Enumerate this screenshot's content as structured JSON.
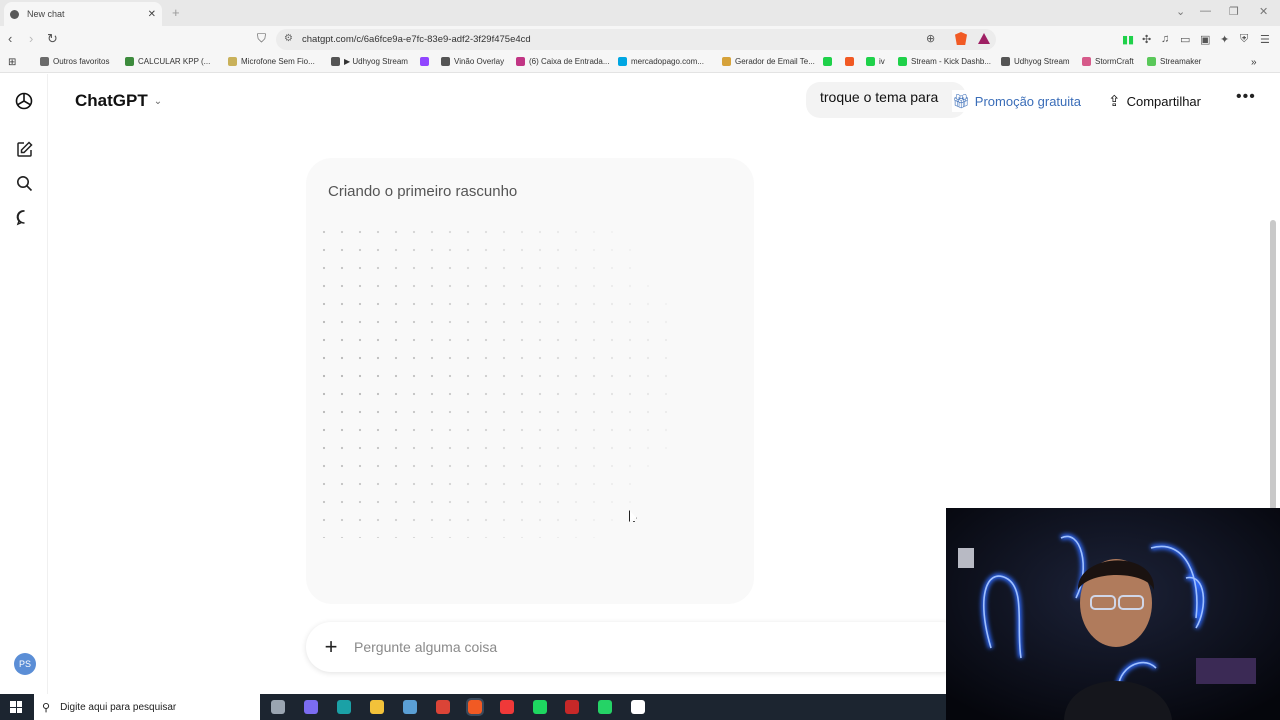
{
  "browser": {
    "tab_title": "New chat",
    "tab_close": "✕",
    "new_tab": "+",
    "url": "chatgpt.com/c/6a6fce9a-e7fc-83e9-adf2-3f29f475e4cd",
    "bookmarks": [
      {
        "label": "Outros favoritos",
        "color": "#6b6b6b"
      },
      {
        "label": "CALCULAR KPP (...",
        "color": "#3d8b3d"
      },
      {
        "label": "Microfone Sem Fio...",
        "color": "#c9b15a"
      },
      {
        "label": "▶ Udhyog Stream",
        "color": "#555555"
      },
      {
        "label": "",
        "color": "#9146ff"
      },
      {
        "label": "Vinão Overlay",
        "color": "#555555"
      },
      {
        "label": "(6) Caixa de Entrada...",
        "color": "#c13584"
      },
      {
        "label": "mercadopago.com...",
        "color": "#00a6e2"
      },
      {
        "label": "Gerador de Email Te...",
        "color": "#d6a23a"
      },
      {
        "label": "",
        "color": "#1fd14a"
      },
      {
        "label": "",
        "color": "#f15a24"
      },
      {
        "label": "iv",
        "color": "#1fd14a"
      },
      {
        "label": "Stream - Kick Dashb...",
        "color": "#1fd14a"
      },
      {
        "label": "Udhyog Stream",
        "color": "#555555"
      },
      {
        "label": "StormCraft",
        "color": "#d65a8a"
      },
      {
        "label": "Streamaker",
        "color": "#5ac85a"
      }
    ]
  },
  "app": {
    "model_name": "ChatGPT",
    "toast_text": "troque o tema para",
    "promo_label": "Promoção gratuita",
    "share_label": "Compartilhar",
    "more_label": "•••",
    "avatar_initials": "PS"
  },
  "canvas": {
    "title": "Criando o primeiro rascunho"
  },
  "composer": {
    "placeholder": "Pergunte alguma coisa"
  },
  "taskbar": {
    "search_placeholder": "Digite aqui para pesquisar",
    "apps": [
      {
        "name": "task-view",
        "color": "#9aa5b1"
      },
      {
        "name": "copilot",
        "color": "#7b6cf0"
      },
      {
        "name": "edge",
        "color": "#1ba1a6"
      },
      {
        "name": "file-explorer",
        "color": "#f2c23a"
      },
      {
        "name": "app",
        "color": "#5a9fd4"
      },
      {
        "name": "chrome",
        "color": "#db4437"
      },
      {
        "name": "brave",
        "color": "#f15a24"
      },
      {
        "name": "vivaldi",
        "color": "#ef3939"
      },
      {
        "name": "spotify",
        "color": "#1ed760"
      },
      {
        "name": "voicemeeter",
        "color": "#c62828"
      },
      {
        "name": "whatsapp",
        "color": "#25d366"
      },
      {
        "name": "app",
        "color": "#ffffff"
      }
    ]
  }
}
